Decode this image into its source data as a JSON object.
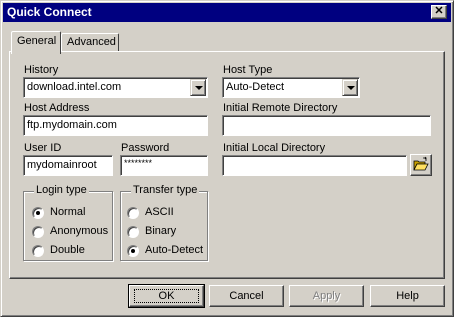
{
  "window": {
    "title": "Quick Connect",
    "close_glyph": "✕"
  },
  "tabs": [
    {
      "label": "General",
      "active": true
    },
    {
      "label": "Advanced",
      "active": false
    }
  ],
  "history": {
    "label": "History",
    "value": "download.intel.com"
  },
  "host_type": {
    "label": "Host Type",
    "value": "Auto-Detect"
  },
  "host_address": {
    "label": "Host Address",
    "value": "ftp.mydomain.com"
  },
  "initial_remote_directory": {
    "label": "Initial Remote Directory",
    "value": ""
  },
  "user_id": {
    "label": "User ID",
    "value": "mydomainroot"
  },
  "password": {
    "label": "Password",
    "value": "********"
  },
  "initial_local_directory": {
    "label": "Initial Local Directory",
    "value": "",
    "browse_icon": "open-folder-icon"
  },
  "login_type": {
    "title": "Login type",
    "options": [
      {
        "label": "Normal",
        "checked": true
      },
      {
        "label": "Anonymous",
        "checked": false
      },
      {
        "label": "Double",
        "checked": false
      }
    ]
  },
  "transfer_type": {
    "title": "Transfer type",
    "options": [
      {
        "label": "ASCII",
        "checked": false
      },
      {
        "label": "Binary",
        "checked": false
      },
      {
        "label": "Auto-Detect",
        "checked": true
      }
    ]
  },
  "buttons": {
    "ok": "OK",
    "cancel": "Cancel",
    "apply": "Apply",
    "help": "Help"
  },
  "colors": {
    "titlebar": "#000080",
    "face": "#d4d0c8"
  }
}
